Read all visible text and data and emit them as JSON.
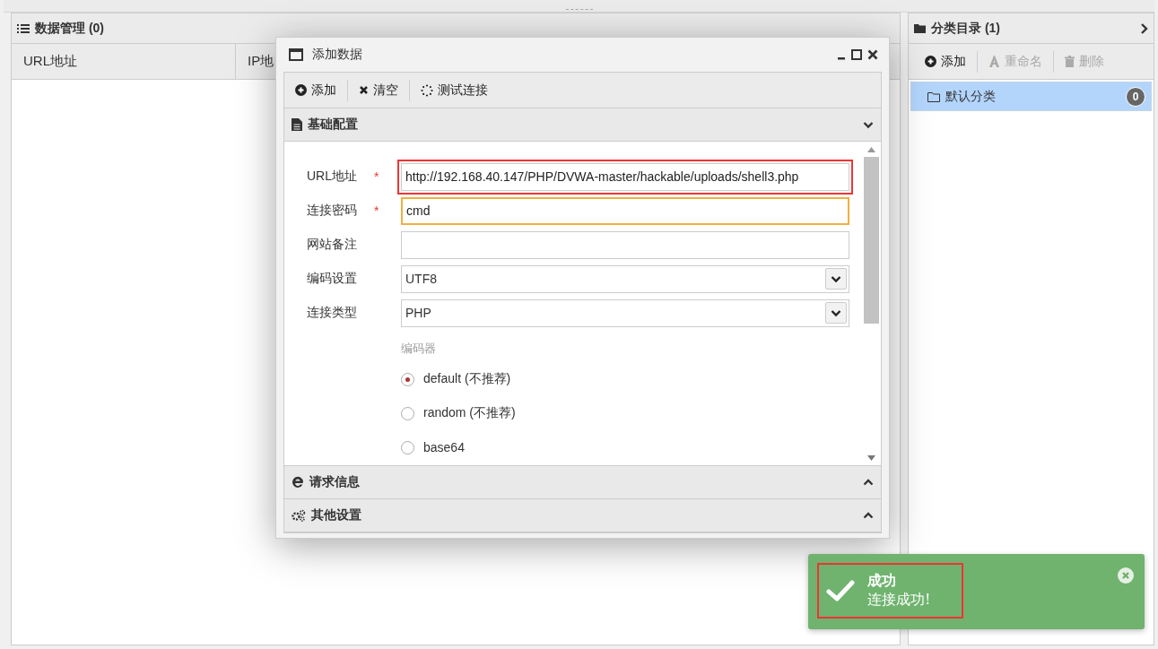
{
  "data_panel": {
    "title": "数据管理 (0)",
    "columns": [
      "URL地址",
      "IP地"
    ]
  },
  "category_panel": {
    "title": "分类目录 (1)",
    "toolbar": [
      {
        "label": "添加",
        "disabled": false
      },
      {
        "label": "重命名",
        "disabled": true
      },
      {
        "label": "删除",
        "disabled": true
      }
    ],
    "items": [
      {
        "label": "默认分类",
        "count": "0",
        "selected": true
      }
    ]
  },
  "dialog": {
    "title": "添加数据",
    "toolbar": [
      {
        "label": "添加"
      },
      {
        "label": "清空"
      },
      {
        "label": "测试连接"
      }
    ],
    "sections": [
      {
        "title": "基础配置",
        "expanded": true
      },
      {
        "title": "请求信息",
        "expanded": false
      },
      {
        "title": "其他设置",
        "expanded": false
      }
    ],
    "fields": [
      {
        "label": "URL地址",
        "marker": "*",
        "kind": "text",
        "value": "http://192.168.40.147/PHP/DVWA-master/hackable/uploads/shell3.php",
        "highlighted": true
      },
      {
        "label": "连接密码",
        "marker": "*",
        "kind": "text",
        "value": "cmd",
        "focused": true
      },
      {
        "label": "网站备注",
        "kind": "text"
      },
      {
        "label": "编码设置",
        "kind": "select",
        "value": "UTF8"
      },
      {
        "label": "连接类型",
        "kind": "select",
        "value": "PHP"
      }
    ],
    "encoder": {
      "label": "编码器",
      "options": [
        {
          "label": "default (不推荐)",
          "selected": true
        },
        {
          "label": "random (不推荐)",
          "selected": false
        },
        {
          "label": "base64",
          "selected": false
        }
      ]
    }
  },
  "toast": {
    "title": "成功",
    "message": "连接成功!",
    "highlighted": true
  }
}
